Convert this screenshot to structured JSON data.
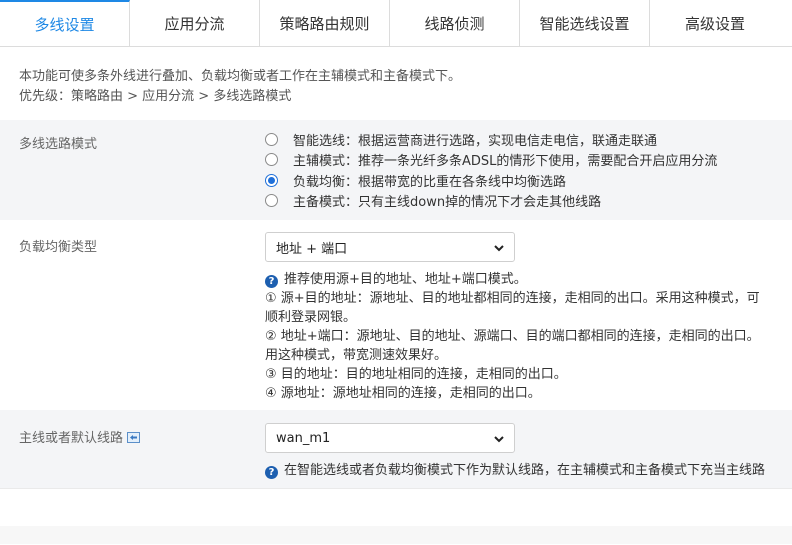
{
  "tabs": [
    {
      "label": "多线设置",
      "active": true
    },
    {
      "label": "应用分流",
      "active": false
    },
    {
      "label": "策略路由规则",
      "active": false
    },
    {
      "label": "线路侦测",
      "active": false
    },
    {
      "label": "智能选线设置",
      "active": false
    },
    {
      "label": "高级设置",
      "active": false
    }
  ],
  "intro": {
    "description": "本功能可使多条外线进行叠加、负载均衡或者工作在主辅模式和主备模式下。",
    "priority": "优先级：策略路由 > 应用分流 > 多线选路模式"
  },
  "mode": {
    "label": "多线选路模式",
    "options": [
      {
        "text": "智能选线：根据运营商进行选路，实现电信走电信，联通走联通",
        "checked": false
      },
      {
        "text": "主辅模式：推荐一条光纤多条ADSL的情形下使用，需要配合开启应用分流",
        "checked": false
      },
      {
        "text": "负载均衡：根据带宽的比重在各条线中均衡选路",
        "checked": true
      },
      {
        "text": "主备模式：只有主线down掉的情况下才会走其他线路",
        "checked": false
      }
    ]
  },
  "lb_type": {
    "label": "负载均衡类型",
    "selected": "地址 + 端口",
    "help": [
      "推荐使用源+目的地址、地址+端口模式。",
      "① 源+目的地址：源地址、目的地址都相同的连接，走相同的出口。采用这种模式，可",
      "顺利登录网银。",
      "② 地址+端口：源地址、目的地址、源端口、目的端口都相同的连接，走相同的出口。",
      "用这种模式，带宽测速效果好。",
      "③ 目的地址：目的地址相同的连接，走相同的出口。",
      "④ 源地址：源地址相同的连接，走相同的出口。"
    ]
  },
  "default_line": {
    "label": "主线或者默认线路",
    "selected": "wan_m1",
    "help": "在智能选线或者负载均衡模式下作为默认线路，在主辅模式和主备模式下充当主线路"
  },
  "colors": {
    "accent": "#1e88e5",
    "radio_checked": "#1e6fd9",
    "band_bg": "#f4f5f7"
  }
}
